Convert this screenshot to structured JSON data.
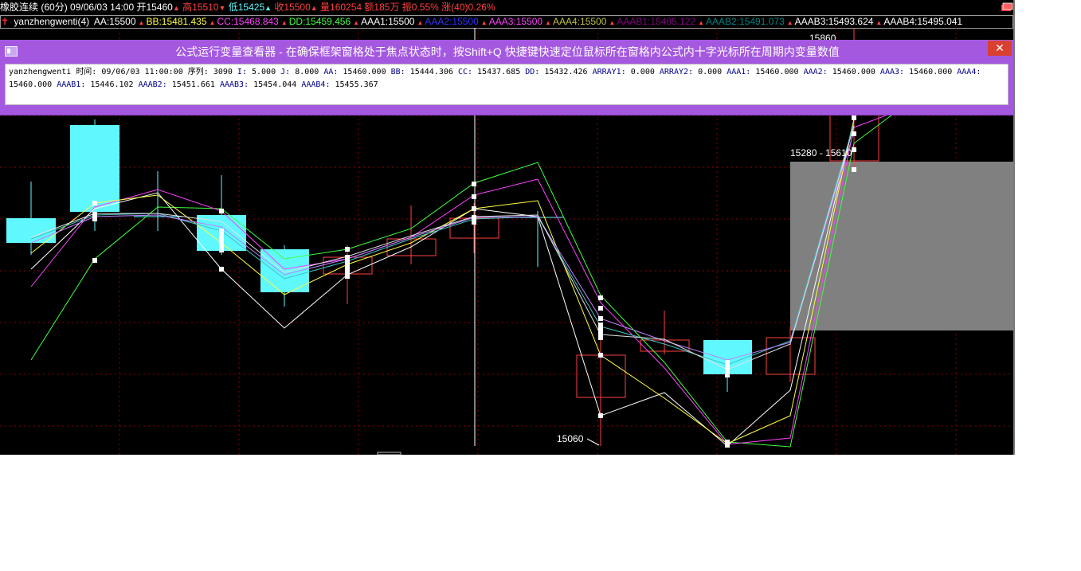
{
  "title_bar": {
    "symbol": "橡胶连续",
    "period": "(60分)",
    "datetime": "09/06/03 14:00",
    "open": "开15460",
    "high": "高15510",
    "low": "低15425",
    "close": "收15500",
    "volume": "量160254",
    "amount": "额185万",
    "amplitude": "振0.55%",
    "change": "涨(40)0.26%",
    "colors": {
      "white": "#ffffff",
      "red": "#ff4040",
      "cyan": "#5ff8ff"
    }
  },
  "formula_bar": {
    "name": "yanzhengwenti(4)",
    "items": [
      {
        "label": "AA:15500",
        "color": "#ffffff"
      },
      {
        "label": "BB:15481.435",
        "color": "#ffff40"
      },
      {
        "label": "CC:15468.843",
        "color": "#ff40ff"
      },
      {
        "label": "DD:15459.456",
        "color": "#40ff40"
      },
      {
        "label": "AAA1:15500",
        "color": "#ffffff"
      },
      {
        "label": "AAA2:15500",
        "color": "#3030ff"
      },
      {
        "label": "AAA3:15500",
        "color": "#ff40ff"
      },
      {
        "label": "AAA4:15500",
        "color": "#c0c040"
      },
      {
        "label": "AAAB1:15485.122",
        "color": "#800080"
      },
      {
        "label": "AAAB2:15491.073",
        "color": "#008080"
      },
      {
        "label": "AAAB3:15493.624",
        "color": "#ffffff"
      },
      {
        "label": "AAAB4:15495.041",
        "color": "#ffffff"
      }
    ]
  },
  "viewer": {
    "title": "公式运行变量查看器 - 在确保框架窗格处于焦点状态时，按Shift+Q 快捷键快速定位鼠标所在窗格内公式内十字光标所在周期内变量数值",
    "close_label": "✕",
    "line1": [
      {
        "k": "yanzhengwenti",
        "v": ""
      },
      {
        "k": "时间:",
        "v": "09/06/03 11:00:00"
      },
      {
        "k": "序列:",
        "v": "3090"
      },
      {
        "k": "I:",
        "v": "5.000"
      },
      {
        "k": "J:",
        "v": "8.000"
      },
      {
        "k": "AA:",
        "v": "15460.000"
      },
      {
        "k": "BB:",
        "v": "15444.306"
      },
      {
        "k": "CC:",
        "v": "15437.685"
      },
      {
        "k": "DD:",
        "v": "15432.426"
      },
      {
        "k": "ARRAY1:",
        "v": "0.000"
      },
      {
        "k": "ARRAY2:",
        "v": "0.000"
      },
      {
        "k": "AAA1:",
        "v": "15460.000"
      },
      {
        "k": "AAA2:",
        "v": "15460.000"
      },
      {
        "k": "AAA3:",
        "v": "15460.000"
      },
      {
        "k": "AAA4:",
        "v": ""
      }
    ],
    "line2": [
      {
        "k": "",
        "v": "15460.000"
      },
      {
        "k": "AAAB1:",
        "v": "15446.102"
      },
      {
        "k": "AAAB2:",
        "v": "15451.661"
      },
      {
        "k": "AAAB3:",
        "v": "15454.044"
      },
      {
        "k": "AAAB4:",
        "v": "15455.367"
      }
    ]
  },
  "chart": {
    "label_top": "15860",
    "label_range": "15280 - 15610",
    "label_bottom": "15060",
    "colors": {
      "up": "#ff4040",
      "down": "#5ff8ff",
      "grid": "#8b0000",
      "overlay": "#808080"
    }
  }
}
